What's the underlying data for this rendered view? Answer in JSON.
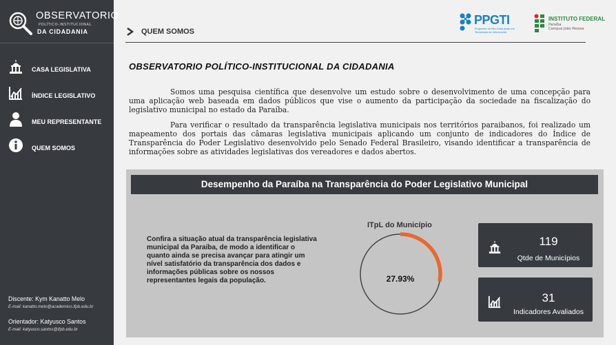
{
  "brand": {
    "title": "OBSERVATORIO",
    "subtitle": "POLÍTICO-INSTITUCIONAL",
    "tagline": "DA CIDADANIA"
  },
  "sidebar": {
    "items": [
      {
        "label": "CASA LEGISLATIVA",
        "icon": "capitol-icon"
      },
      {
        "label": "ÍNDICE LEGISLATIVO",
        "icon": "chart-icon"
      },
      {
        "label": "MEU REPRESENTANTE",
        "icon": "person-icon"
      },
      {
        "label": "QUEM SOMOS",
        "icon": "info-icon"
      }
    ],
    "credits": {
      "student_name": "Discente: Kym Kanatto Melo",
      "student_email": "E-mail: kanatto.melo@academico.ifpb.edu.br",
      "advisor_name": "Orientador: Katyusco Santos",
      "advisor_email": "E-mail: katyusco.santos@ifpb.edu.br"
    }
  },
  "header": {
    "breadcrumb": "QUEM SOMOS",
    "logo_ppgti": "PPGTI",
    "logo_ppgti_sub": "Programa de Pós-Graduação em Tecnologia da Informação",
    "logo_ifpb_title": "INSTITUTO FEDERAL",
    "logo_ifpb_sub1": "Paraíba",
    "logo_ifpb_sub2": "Campus João Pessoa"
  },
  "main": {
    "title": "OBSERVATORIO POLÍTICO-INSTITUCIONAL DA CIDADANIA",
    "paragraph1": "Somos uma pesquisa científica que desenvolve um estudo sobre o desenvolvimento de uma concepção para uma aplicação web baseada em dados públicos que vise o aumento da participação da sociedade na fiscalização do legislativo municipal no estado da Paraíba.",
    "paragraph2": "Para verificar o resultado da transparência legislativa municipais nos territórios paraibanos, foi realizado um mapeamento dos portais das câmaras legislativa municipais aplicando um conjunto de indicadores do Índice de Transparência do Poder Legislativo desenvolvido pelo Senado Federal Brasileiro, visando identificar a transparência de informações sobre as atividades legislativas dos vereadores e dados abertos."
  },
  "panel": {
    "heading": "Desempenho da Paraíba na Transparência do Poder Legislativo Municipal",
    "description": "Confira a situação atual da transparência legislativa municipal da Paraíba, de modo a identificar o quanto ainda se precisa avançar para atingir um nível satisfatório da transparência dos dados e informações públicas sobre os nossos representantes legais da população.",
    "gauge_title": "ITpL do Município",
    "gauge_value_label": "27.93%",
    "gauge_fraction": 0.2793,
    "gauge_color": "#e8692e",
    "cards": [
      {
        "value": "119",
        "label": "Qtde de Municípios",
        "icon": "capitol-icon"
      },
      {
        "value": "31",
        "label": "Indicadores Avaliados",
        "icon": "chart-icon"
      }
    ]
  },
  "colors": {
    "sidebar": "#373b40",
    "panel": "#c5c5c5",
    "accent": "#e8692e",
    "ppgti_blue": "#1b7fc4",
    "ifpb_green": "#2b8a3e"
  }
}
